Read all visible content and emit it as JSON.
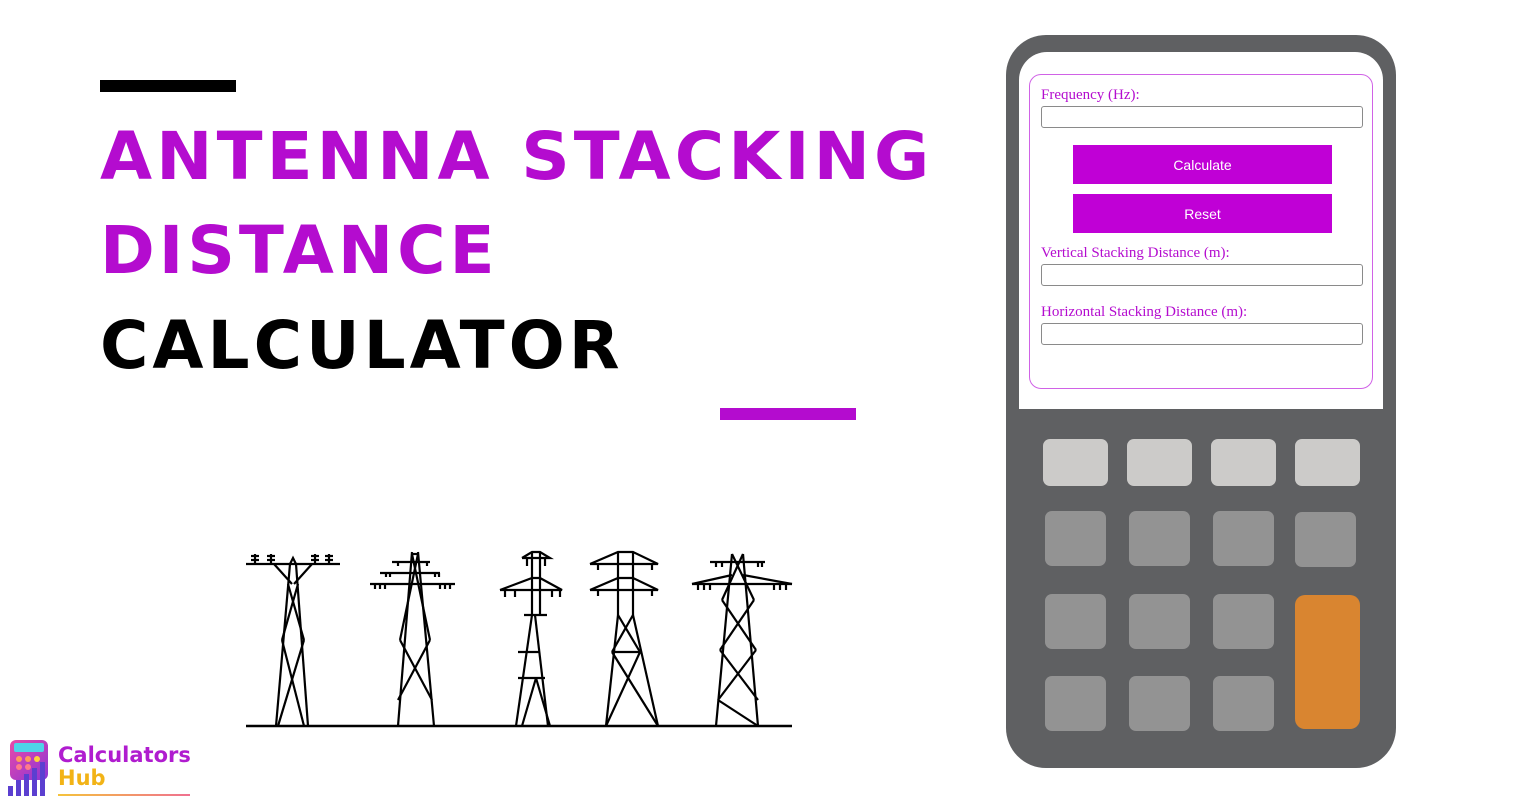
{
  "hero": {
    "title_line1": "Antenna Stacking",
    "title_line2": "Distance",
    "title_line3": "Calculator",
    "accent_color": "#b40ccf",
    "secondary_color": "#000000"
  },
  "illustration": {
    "icon": "transmission-towers-icon",
    "tower_count": 5
  },
  "calculator": {
    "fields": {
      "frequency": {
        "label": "Frequency (Hz):",
        "value": ""
      },
      "vertical": {
        "label": "Vertical Stacking Distance (m):",
        "value": ""
      },
      "horizontal": {
        "label": "Horizontal Stacking Distance (m):",
        "value": ""
      }
    },
    "buttons": {
      "calculate": "Calculate",
      "reset": "Reset"
    },
    "colors": {
      "body": "#5f6062",
      "button": "#c000d6",
      "key_light": "#cccbc9",
      "key_mid": "#939393",
      "key_accent": "#d98530"
    }
  },
  "brand": {
    "line1": "Calculators",
    "line2": "Hub"
  }
}
